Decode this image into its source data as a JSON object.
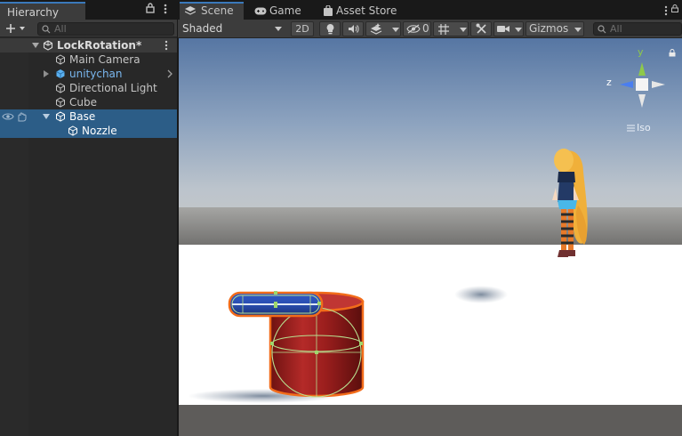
{
  "hierarchy": {
    "tab_label": "Hierarchy",
    "search_placeholder": "All",
    "scene_name": "LockRotation*",
    "items": [
      {
        "label": "Main Camera"
      },
      {
        "label": "unitychan"
      },
      {
        "label": "Directional Light"
      },
      {
        "label": "Cube"
      },
      {
        "label": "Base"
      },
      {
        "label": "Nozzle"
      }
    ]
  },
  "scene_tabs": [
    {
      "label": "Scene",
      "icon": "scene-icon",
      "active": true
    },
    {
      "label": "Game",
      "icon": "gamepad-icon",
      "active": false
    },
    {
      "label": "Asset Store",
      "icon": "shopping-bag-icon",
      "active": false
    }
  ],
  "scene_toolbar": {
    "shading_mode": "Shaded",
    "mode_2d": "2D",
    "hidden_count": "0",
    "gizmos_label": "Gizmos",
    "search_placeholder": "All"
  },
  "view_gizmo": {
    "y_axis": "y",
    "z_axis": "z",
    "projection": "Iso"
  },
  "colors": {
    "selection": "#2c5d87",
    "accent": "#3a79bb",
    "prefab_text": "#7ab7ef",
    "selection_outline": "#f26c1a"
  }
}
